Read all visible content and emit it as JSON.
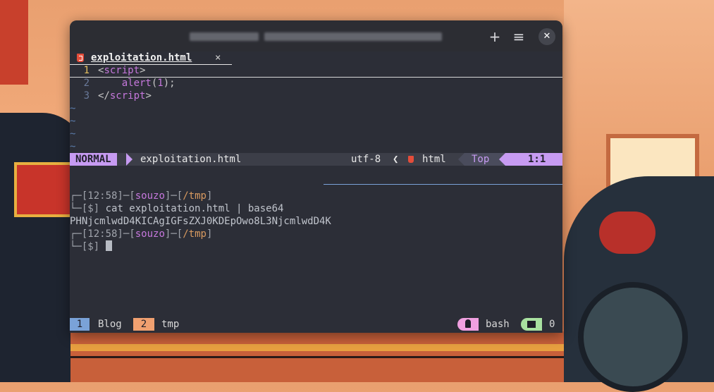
{
  "window": {
    "new_tab_icon": "plus-icon",
    "menu_icon": "hamburger-menu-icon",
    "close_icon": "close-icon",
    "plus_glyph": "+",
    "menu_glyph": "≡",
    "close_glyph": "✕"
  },
  "editor": {
    "tab": {
      "name": "exploitation.html",
      "close": "×",
      "icon": "html5-icon"
    },
    "lines": [
      {
        "num": "1",
        "parts": [
          [
            "<",
            "c-punct"
          ],
          [
            "script",
            "c-tag"
          ],
          [
            ">",
            "c-punct"
          ]
        ]
      },
      {
        "num": "2",
        "parts": [
          [
            "    alert",
            "c-fn"
          ],
          [
            "(",
            "c-punct"
          ],
          [
            "1",
            "c-num"
          ],
          [
            ");",
            "c-punct"
          ]
        ]
      },
      {
        "num": "3",
        "parts": [
          [
            "</",
            "c-punct"
          ],
          [
            "script",
            "c-tag"
          ],
          [
            ">",
            "c-punct"
          ]
        ]
      }
    ],
    "tilde": "~",
    "status": {
      "mode": "NORMAL",
      "file": "exploitation.html",
      "encoding": "utf-8",
      "separator": "❮",
      "filetype": "html",
      "position": "Top",
      "cursor": "1:1"
    }
  },
  "shell": {
    "lines": [
      {
        "type": "prompt_head",
        "corner": "┌─",
        "time": "[12:58]",
        "dash": "─",
        "user_open": "[",
        "user": "souzo",
        "user_close": "]",
        "dash2": "─",
        "dir_open": "[",
        "dir": "/tmp",
        "dir_close": "]"
      },
      {
        "type": "prompt_cmd",
        "corner": "└─",
        "prompt": "[$]",
        "command": " cat exploitation.html | base64"
      },
      {
        "type": "output",
        "text": "PHNjcmlwdD4KICAgIGFsZXJ0KDEpOwo8L3NjcmlwdD4K"
      },
      {
        "type": "prompt_head",
        "corner": "┌─",
        "time": "[12:58]",
        "dash": "─",
        "user_open": "[",
        "user": "souzo",
        "user_close": "]",
        "dash2": "─",
        "dir_open": "[",
        "dir": "/tmp",
        "dir_close": "]"
      },
      {
        "type": "prompt_cmd",
        "corner": "└─",
        "prompt": "[$]",
        "command": " "
      }
    ]
  },
  "tmux": {
    "windows": [
      {
        "num": "1",
        "name": "Blog"
      },
      {
        "num": "2",
        "name": "tmp"
      }
    ],
    "session": "bash",
    "session_icon": "process-icon",
    "count": "0",
    "count_icon": "flag-icon"
  }
}
